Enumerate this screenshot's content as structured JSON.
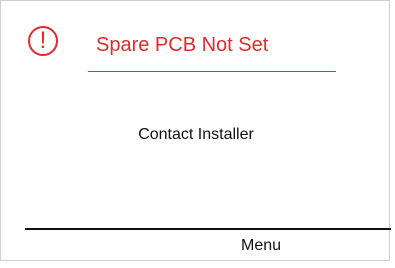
{
  "alert": {
    "icon": "exclamation-circle-icon",
    "glyph": "!",
    "title": "Spare PCB Not Set"
  },
  "body": {
    "message": "Contact Installer"
  },
  "footer": {
    "menu_label": "Menu"
  },
  "colors": {
    "alert_red": "#e22b2b",
    "text": "#111111",
    "background": "#ffffff"
  }
}
